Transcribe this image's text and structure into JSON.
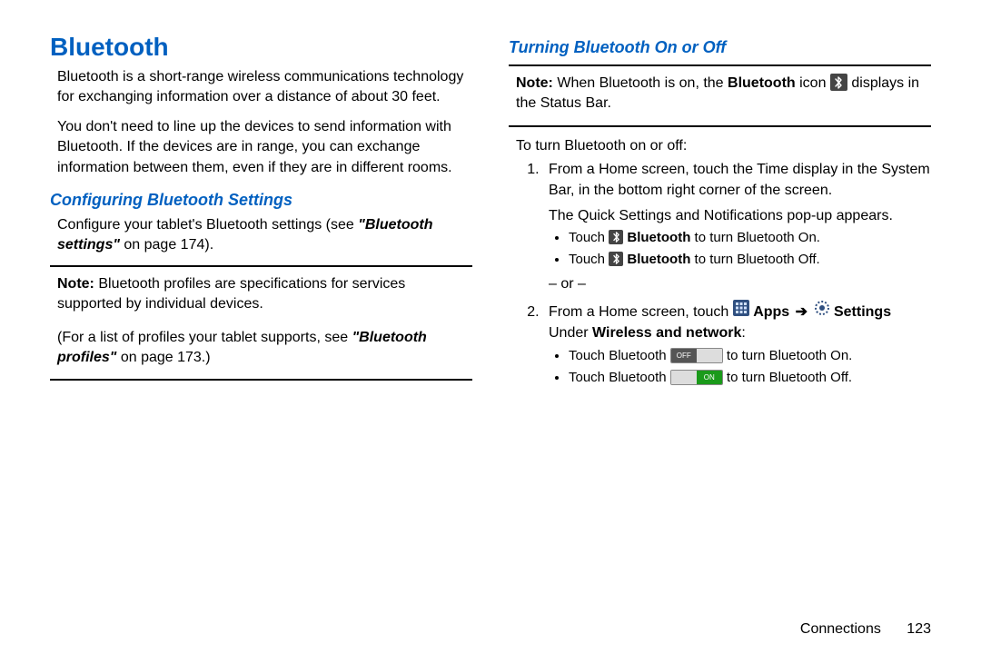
{
  "left": {
    "title": "Bluetooth",
    "p1": "Bluetooth is a short-range wireless communications technology for exchanging information over a distance of about 30 feet.",
    "p2": "You don't need to line up the devices to send information with Bluetooth. If the devices are in range, you can exchange information between them, even if they are in different rooms.",
    "sub1": "Configuring Bluetooth Settings",
    "conf_a": "Configure your tablet's Bluetooth settings (see ",
    "conf_b": "\"Bluetooth settings\"",
    "conf_c": " on page 174).",
    "note1_label": "Note:",
    "note1_a": "Bluetooth profiles are specifications for services supported by individual devices.",
    "note1_b": "(For a list of profiles your tablet supports, see ",
    "note1_c": "\"Bluetooth profiles\"",
    "note1_d": " on page 173.)"
  },
  "right": {
    "sub": "Turning Bluetooth On or Off",
    "note_label": "Note:",
    "note_a": "When Bluetooth is on, the ",
    "note_b": "Bluetooth",
    "note_c": " icon ",
    "note_d": " displays in the Status Bar.",
    "lead": "To turn Bluetooth on or off:",
    "step1a": "From a Home screen, touch the Time display in the System Bar, in the bottom right corner of the screen.",
    "step1b": "The Quick Settings and Notifications pop-up appears.",
    "s1_b1a": "Touch ",
    "s1_b1b": "Bluetooth",
    "s1_b1c": " to turn Bluetooth On.",
    "s1_b2a": "Touch ",
    "s1_b2b": "Bluetooth",
    "s1_b2c": " to turn Bluetooth Off.",
    "or": "– or –",
    "step2a": "From a Home screen, touch ",
    "step2_apps": "Apps",
    "step2_arrow": "➔",
    "step2_settings": "Settings",
    "step2b": "Under ",
    "step2c": "Wireless and network",
    "step2d": ":",
    "s2_b1a": "Touch Bluetooth ",
    "s2_b1b": " to turn Bluetooth On.",
    "s2_b2a": "Touch Bluetooth ",
    "s2_b2b": " to turn Bluetooth Off.",
    "tog_off": "OFF",
    "tog_on": "ON"
  },
  "footer": {
    "chapter": "Connections",
    "page": "123"
  }
}
